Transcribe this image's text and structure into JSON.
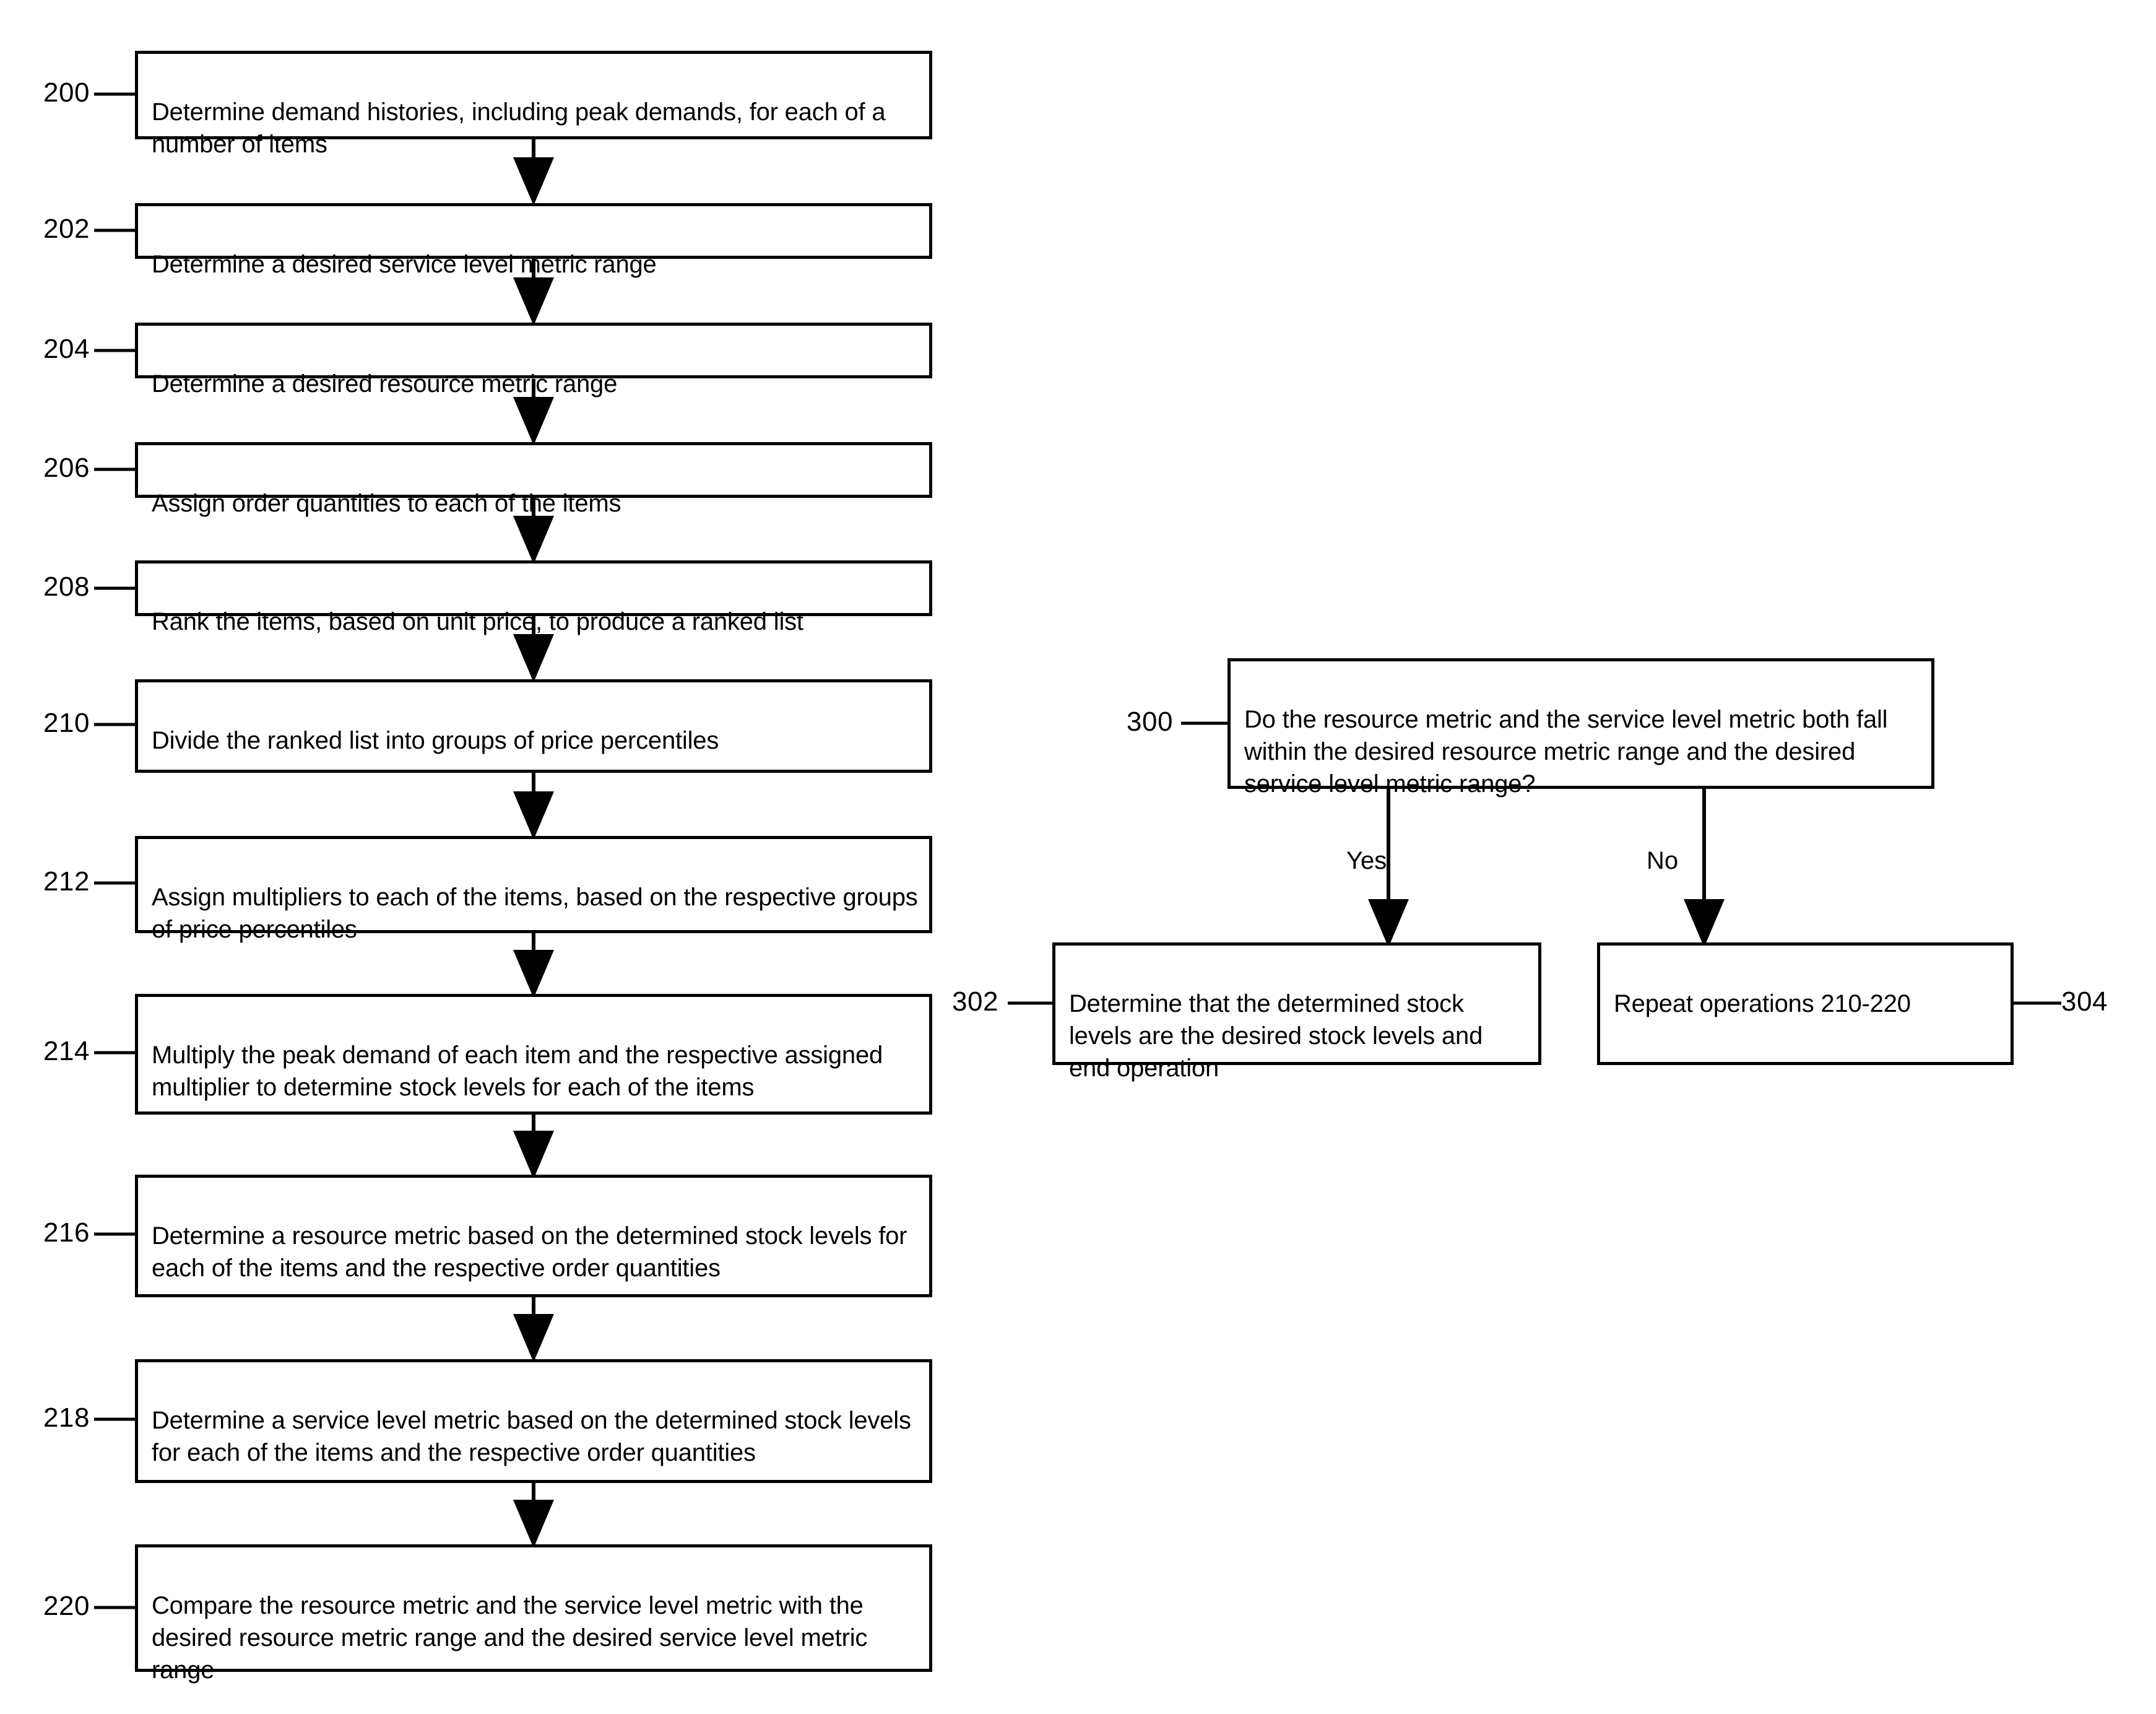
{
  "figure": {
    "type": "patent-flowchart",
    "background_color": "#ffffff",
    "line_color": "#000000"
  },
  "left_flow": {
    "nodes": [
      {
        "ref": "200",
        "text": "Determine demand histories, including peak demands, for each of a number of items"
      },
      {
        "ref": "202",
        "text": "Determine a desired service level metric range"
      },
      {
        "ref": "204",
        "text": "Determine a desired resource metric range"
      },
      {
        "ref": "206",
        "text": "Assign order quantities to each of the items"
      },
      {
        "ref": "208",
        "text": "Rank the items, based on unit price, to produce a ranked list"
      },
      {
        "ref": "210",
        "text": "Divide the ranked list into groups of price percentiles"
      },
      {
        "ref": "212",
        "text": "Assign multipliers to each of the items, based on the respective groups of price percentiles"
      },
      {
        "ref": "214",
        "text": "Multiply the peak demand of each item and the respective assigned multiplier to determine stock levels for each of the items"
      },
      {
        "ref": "216",
        "text": "Determine a resource metric based on the determined stock levels for each of the items and the respective order quantities"
      },
      {
        "ref": "218",
        "text": "Determine a service level metric based on the determined stock levels for each of the items and the respective order quantities"
      },
      {
        "ref": "220",
        "text": "Compare the resource metric and the service level metric with the desired resource metric range and the desired service level metric range"
      }
    ]
  },
  "right_flow": {
    "decision": {
      "ref": "300",
      "text": "Do the resource metric and the service level metric both fall within the desired resource metric range and the desired service level metric range?"
    },
    "branch_labels": {
      "yes": "Yes",
      "no": "No"
    },
    "outcomes": [
      {
        "ref": "302",
        "text": "Determine that the determined stock levels are the desired stock levels and end operation"
      },
      {
        "ref": "304",
        "text": "Repeat operations 210-220"
      }
    ]
  }
}
